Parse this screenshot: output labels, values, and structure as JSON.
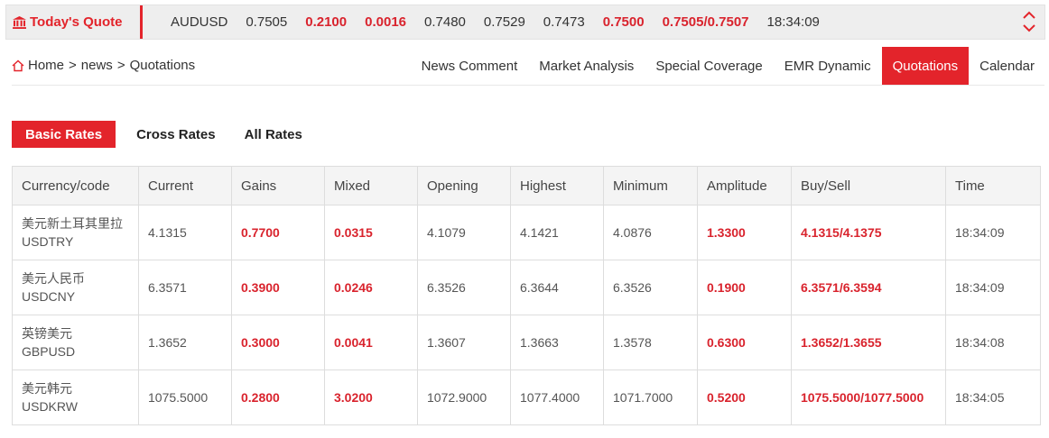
{
  "ticker": {
    "title": "Today's Quote",
    "symbol": "AUDUSD",
    "values": [
      "0.7505",
      "0.2100",
      "0.0016",
      "0.7480",
      "0.7529",
      "0.7473",
      "0.7500",
      "0.7505/0.7507",
      "18:34:09"
    ],
    "red_indices": [
      1,
      2,
      6,
      7
    ]
  },
  "breadcrumb": {
    "home": "Home",
    "sep1": ">",
    "news": "news",
    "sep2": ">",
    "current": "Quotations"
  },
  "nav": {
    "items": [
      "News Comment",
      "Market Analysis",
      "Special Coverage",
      "EMR Dynamic",
      "Quotations",
      "Calendar"
    ],
    "active_index": 4
  },
  "subtabs": {
    "basic": "Basic Rates",
    "cross": "Cross Rates",
    "all": "All Rates"
  },
  "table": {
    "headers": [
      "Currency/code",
      "Current",
      "Gains",
      "Mixed",
      "Opening",
      "Highest",
      "Minimum",
      "Amplitude",
      "Buy/Sell",
      "Time"
    ],
    "rows": [
      {
        "name": "美元新土耳其里拉",
        "code": "USDTRY",
        "current": "4.1315",
        "gains": "0.7700",
        "mixed": "0.0315",
        "opening": "4.1079",
        "highest": "4.1421",
        "minimum": "4.0876",
        "amplitude": "1.3300",
        "buysell": "4.1315/4.1375",
        "time": "18:34:09"
      },
      {
        "name": "美元人民币",
        "code": "USDCNY",
        "current": "6.3571",
        "gains": "0.3900",
        "mixed": "0.0246",
        "opening": "6.3526",
        "highest": "6.3644",
        "minimum": "6.3526",
        "amplitude": "0.1900",
        "buysell": "6.3571/6.3594",
        "time": "18:34:09"
      },
      {
        "name": "英镑美元",
        "code": "GBPUSD",
        "current": "1.3652",
        "gains": "0.3000",
        "mixed": "0.0041",
        "opening": "1.3607",
        "highest": "1.3663",
        "minimum": "1.3578",
        "amplitude": "0.6300",
        "buysell": "1.3652/1.3655",
        "time": "18:34:08"
      },
      {
        "name": "美元韩元",
        "code": "USDKRW",
        "current": "1075.5000",
        "gains": "0.2800",
        "mixed": "3.0200",
        "opening": "1072.9000",
        "highest": "1077.4000",
        "minimum": "1071.7000",
        "amplitude": "0.5200",
        "buysell": "1075.5000/1077.5000",
        "time": "18:34:05"
      }
    ]
  },
  "colors": {
    "accent": "#e3242b",
    "value_red": "#d9232d",
    "ticker_bg": "#eeeeee",
    "header_bg": "#f4f4f4",
    "border": "#dddddd"
  },
  "icons": {
    "ticker": "bank-icon",
    "breadcrumb": "home-icon",
    "scroll": "up-down-chevron-icon"
  }
}
